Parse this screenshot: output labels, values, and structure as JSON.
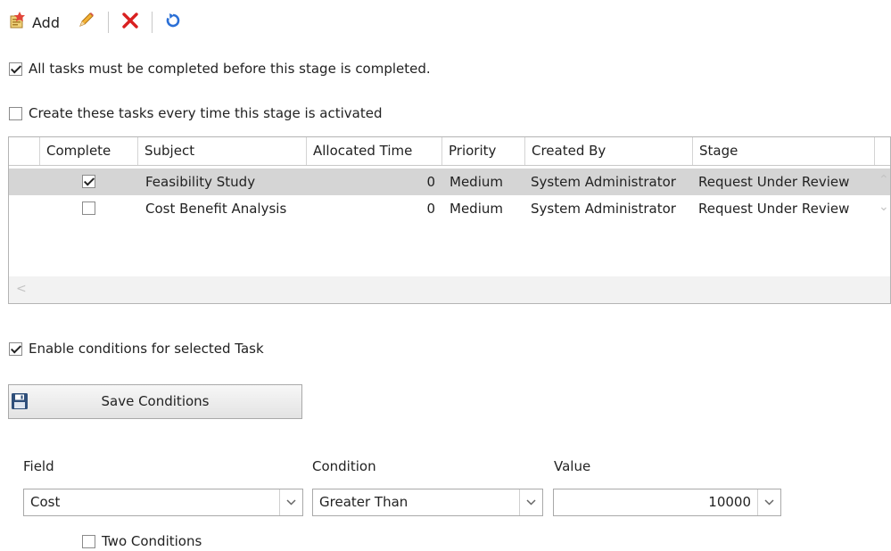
{
  "toolbar": {
    "add_label": "Add",
    "add_icon": "add-task-icon",
    "edit_icon": "pencil-icon",
    "delete_icon": "delete-x-icon",
    "refresh_icon": "refresh-icon"
  },
  "options": {
    "all_tasks_label": "All tasks must be completed before this stage is completed.",
    "all_tasks_checked": true,
    "create_tasks_label": "Create these tasks every time this stage is activated",
    "create_tasks_checked": false
  },
  "grid": {
    "columns": [
      "Complete",
      "Subject",
      "Allocated Time",
      "Priority",
      "Created By",
      "Stage"
    ],
    "rows": [
      {
        "complete": true,
        "subject": "Feasibility  Study",
        "allocated_time": "0",
        "priority": "Medium",
        "created_by": "System Administrator",
        "stage": "Request Under Review",
        "selected": true
      },
      {
        "complete": false,
        "subject": "Cost Benefit Analysis",
        "allocated_time": "0",
        "priority": "Medium",
        "created_by": "System Administrator",
        "stage": "Request Under Review",
        "selected": false
      }
    ]
  },
  "conditions": {
    "enable_label": "Enable conditions for selected Task",
    "enable_checked": true,
    "save_label": "Save Conditions",
    "save_icon": "floppy-disk-icon",
    "field_label": "Field",
    "field_value": "Cost",
    "condition_label": "Condition",
    "condition_value": "Greater Than",
    "value_label": "Value",
    "value_value": "10000",
    "two_conditions_label": "Two Conditions",
    "two_conditions_checked": false
  },
  "colors": {
    "selected_row": "#d5d5d5",
    "delete_red": "#d92020",
    "refresh_blue": "#2a6fd6"
  }
}
